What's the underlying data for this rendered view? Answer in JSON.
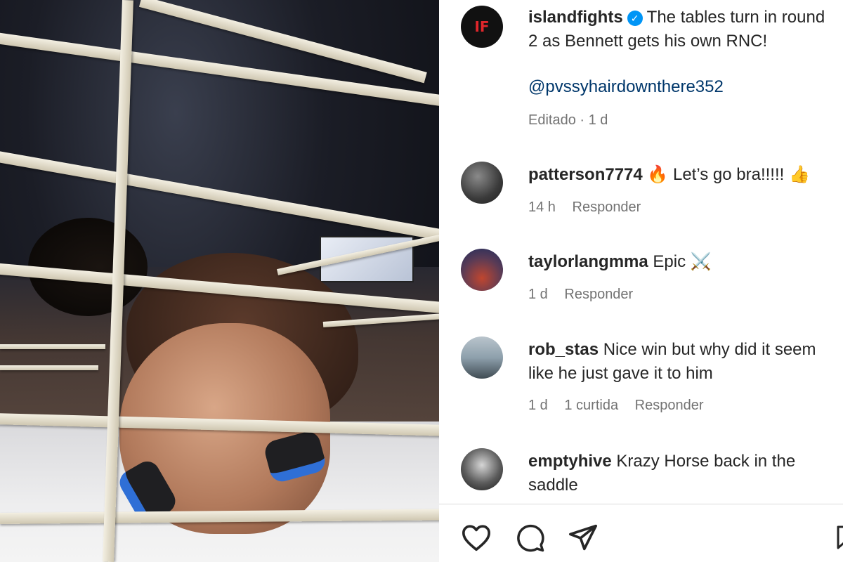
{
  "post": {
    "username": "islandfights",
    "avatar_text": "IF",
    "caption": "The tables turn in round 2 as Bennett gets his own RNC!",
    "mention": "@pvssyhairdownthere352",
    "meta": "Editado · 1 d"
  },
  "comments": [
    {
      "username": "patterson7774",
      "text": "🔥 Let’s go bra!!!!! 👍",
      "time": "14 h",
      "likes": "",
      "reply": "Responder"
    },
    {
      "username": "taylorlangmma",
      "text": "Epic ⚔️",
      "time": "1 d",
      "likes": "",
      "reply": "Responder"
    },
    {
      "username": "rob_stas",
      "text": "Nice win but why did it seem like he just gave it to him",
      "time": "1 d",
      "likes": "1 curtida",
      "reply": "Responder"
    },
    {
      "username": "emptyhive",
      "text": "Krazy Horse back in the saddle",
      "time": "",
      "likes": "",
      "reply": ""
    }
  ],
  "actions": {
    "like_icon": "heart-icon",
    "comment_icon": "comment-icon",
    "share_icon": "send-icon",
    "save_icon": "bookmark-icon"
  },
  "colors": {
    "verified": "#0095f6",
    "mention": "#00376b",
    "meta": "#737373"
  }
}
